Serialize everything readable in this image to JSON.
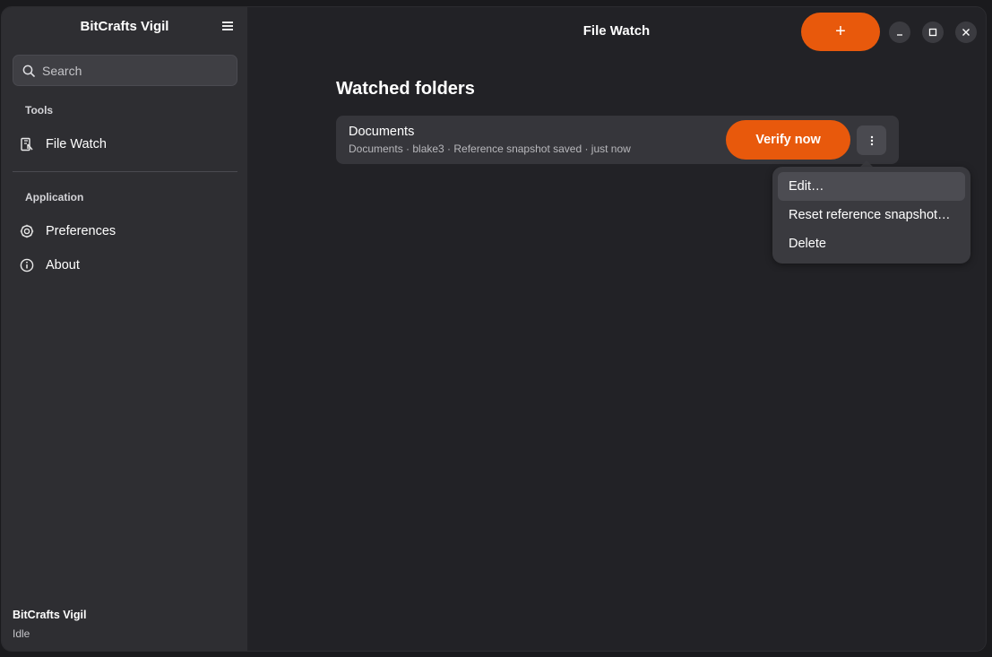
{
  "sidebar": {
    "title": "BitCrafts Vigil",
    "menu_icon": "hamburger-icon",
    "search": {
      "placeholder": "Search",
      "value": ""
    },
    "sections": {
      "tools": "Tools",
      "application": "Application"
    },
    "items": [
      {
        "label": "File Watch",
        "icon": "file-watch-icon"
      },
      {
        "label": "Preferences",
        "icon": "gear-icon"
      },
      {
        "label": "About",
        "icon": "info-icon"
      }
    ],
    "footer": {
      "name": "BitCrafts Vigil",
      "status": "Idle"
    }
  },
  "header": {
    "title": "File Watch",
    "add_label": "+",
    "window_controls": [
      "minimize-icon",
      "maximize-icon",
      "close-icon"
    ]
  },
  "main": {
    "heading": "Watched folders",
    "folders": [
      {
        "title": "Documents",
        "subtitle": "Documents · blake3 · Reference snapshot saved · just now",
        "verify_label": "Verify now"
      }
    ]
  },
  "context_menu": {
    "items": [
      "Edit…",
      "Reset reference snapshot…",
      "Delete"
    ]
  },
  "colors": {
    "accent": "#e8590c",
    "sidebar_bg": "#2e2e32",
    "main_bg": "#222226"
  }
}
